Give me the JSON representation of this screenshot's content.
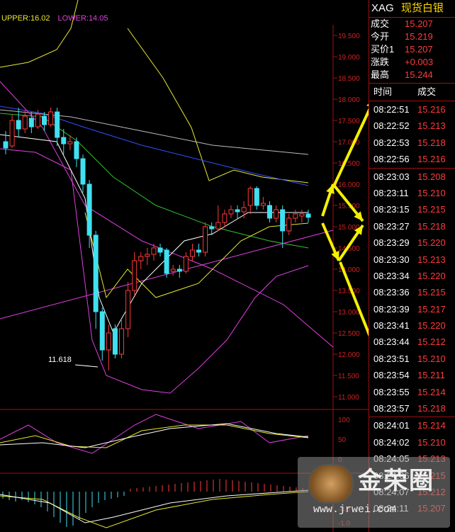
{
  "header": {
    "symbol": "XAG",
    "name": "现货白银"
  },
  "quote": [
    {
      "label": "成交",
      "value": "15.207"
    },
    {
      "label": "今开",
      "value": "15.219"
    },
    {
      "label": "买价1",
      "value": "15.207"
    },
    {
      "label": "涨跌",
      "value": "+0.003"
    },
    {
      "label": "最高",
      "value": "15.244"
    }
  ],
  "trades_header": {
    "time": "时间",
    "price": "成交"
  },
  "trades": [
    {
      "time": "08:22:51",
      "price": "15.216",
      "sep": false
    },
    {
      "time": "08:22:52",
      "price": "15.213",
      "sep": false
    },
    {
      "time": "08:22:53",
      "price": "15.218",
      "sep": false
    },
    {
      "time": "08:22:56",
      "price": "15.216",
      "sep": false
    },
    {
      "time": "08:23:03",
      "price": "15.208",
      "sep": true
    },
    {
      "time": "08:23:11",
      "price": "15.210",
      "sep": false
    },
    {
      "time": "08:23:15",
      "price": "15.215",
      "sep": false
    },
    {
      "time": "08:23:27",
      "price": "15.218",
      "sep": false
    },
    {
      "time": "08:23:29",
      "price": "15.220",
      "sep": false
    },
    {
      "time": "08:23:30",
      "price": "15.213",
      "sep": false
    },
    {
      "time": "08:23:34",
      "price": "15.220",
      "sep": false
    },
    {
      "time": "08:23:36",
      "price": "15.215",
      "sep": false
    },
    {
      "time": "08:23:39",
      "price": "15.217",
      "sep": false
    },
    {
      "time": "08:23:41",
      "price": "15.220",
      "sep": false
    },
    {
      "time": "08:23:44",
      "price": "15.212",
      "sep": false
    },
    {
      "time": "08:23:51",
      "price": "15.210",
      "sep": false
    },
    {
      "time": "08:23:54",
      "price": "15.211",
      "sep": false
    },
    {
      "time": "08:23:55",
      "price": "15.214",
      "sep": false
    },
    {
      "time": "08:23:57",
      "price": "15.218",
      "sep": false
    },
    {
      "time": "08:24:01",
      "price": "15.214",
      "sep": true
    },
    {
      "time": "08:24:02",
      "price": "15.210",
      "sep": false
    },
    {
      "time": "08:24:05",
      "price": "15.213",
      "sep": false
    },
    {
      "time": "08:24:06",
      "price": "15.215",
      "sep": false
    },
    {
      "time": "08:24:07",
      "price": "15.212",
      "sep": false
    },
    {
      "time": "08:24:11",
      "price": "15.207",
      "sep": false
    }
  ],
  "bands": {
    "upper": "UPPER:16.02",
    "lower": "LOWER:14.05"
  },
  "chart": {
    "price_ticks": [
      "19.500",
      "19.000",
      "18.500",
      "18.000",
      "17.500",
      "17.000",
      "16.500",
      "16.000",
      "15.500",
      "15.000",
      "14.500",
      "14.000",
      "13.500",
      "13.000",
      "12.500",
      "12.000",
      "11.500",
      "11.000"
    ],
    "low_label": "11.618",
    "kdj_ticks": [
      "100",
      "50",
      "0"
    ],
    "macd_ticks": [
      "0.0",
      "-0.5",
      "-1.0"
    ],
    "candles": [
      [
        17.0,
        16.85,
        17.25,
        16.7
      ],
      [
        16.9,
        17.5,
        17.65,
        16.85
      ],
      [
        17.5,
        17.3,
        17.8,
        17.1
      ],
      [
        17.3,
        17.6,
        17.75,
        17.2
      ],
      [
        17.55,
        17.35,
        17.7,
        17.2
      ],
      [
        17.35,
        17.65,
        17.75,
        17.3
      ],
      [
        17.6,
        17.4,
        17.7,
        17.25
      ],
      [
        17.4,
        17.7,
        17.8,
        17.35
      ],
      [
        17.7,
        17.1,
        17.8,
        16.9
      ],
      [
        17.1,
        16.95,
        17.3,
        16.7
      ],
      [
        16.95,
        17.0,
        17.15,
        16.8
      ],
      [
        17.0,
        16.6,
        17.1,
        16.4
      ],
      [
        16.6,
        16.0,
        16.7,
        15.8
      ],
      [
        16.0,
        14.8,
        16.1,
        14.5
      ],
      [
        14.8,
        13.0,
        14.9,
        12.6
      ],
      [
        13.0,
        12.1,
        13.1,
        11.85
      ],
      [
        12.1,
        12.5,
        12.7,
        11.62
      ],
      [
        12.6,
        12.0,
        12.7,
        11.9
      ],
      [
        12.0,
        12.6,
        12.8,
        11.9
      ],
      [
        12.6,
        13.5,
        13.7,
        12.4
      ],
      [
        13.5,
        14.2,
        14.4,
        13.4
      ],
      [
        14.2,
        14.3,
        14.4,
        14.0
      ],
      [
        14.3,
        14.35,
        14.5,
        14.1
      ],
      [
        14.35,
        14.5,
        14.6,
        14.2
      ],
      [
        14.5,
        14.4,
        14.6,
        14.3
      ],
      [
        14.45,
        13.9,
        14.5,
        13.8
      ],
      [
        13.95,
        14.0,
        14.1,
        13.85
      ],
      [
        14.0,
        13.95,
        14.1,
        13.8
      ],
      [
        13.95,
        14.3,
        14.4,
        13.9
      ],
      [
        14.3,
        14.45,
        14.6,
        14.2
      ],
      [
        14.45,
        14.4,
        14.6,
        14.3
      ],
      [
        14.4,
        15.0,
        15.1,
        14.3
      ],
      [
        15.0,
        14.95,
        15.1,
        14.8
      ],
      [
        14.95,
        15.1,
        15.5,
        14.9
      ],
      [
        15.1,
        15.3,
        15.4,
        15.0
      ],
      [
        15.3,
        15.4,
        15.5,
        15.2
      ],
      [
        15.4,
        15.35,
        15.5,
        15.2
      ],
      [
        15.35,
        15.45,
        15.6,
        15.2
      ],
      [
        15.5,
        15.9,
        15.95,
        15.3
      ],
      [
        15.9,
        15.5,
        15.95,
        15.4
      ],
      [
        15.5,
        15.55,
        15.7,
        15.4
      ],
      [
        15.5,
        15.2,
        15.6,
        15.1
      ],
      [
        15.2,
        15.4,
        15.5,
        15.1
      ],
      [
        15.4,
        14.9,
        15.5,
        14.5
      ],
      [
        14.9,
        15.2,
        15.3,
        14.8
      ],
      [
        15.2,
        15.3,
        15.4,
        15.1
      ],
      [
        15.25,
        15.3,
        15.4,
        15.1
      ],
      [
        15.3,
        15.22,
        15.4,
        15.1
      ]
    ]
  }
}
